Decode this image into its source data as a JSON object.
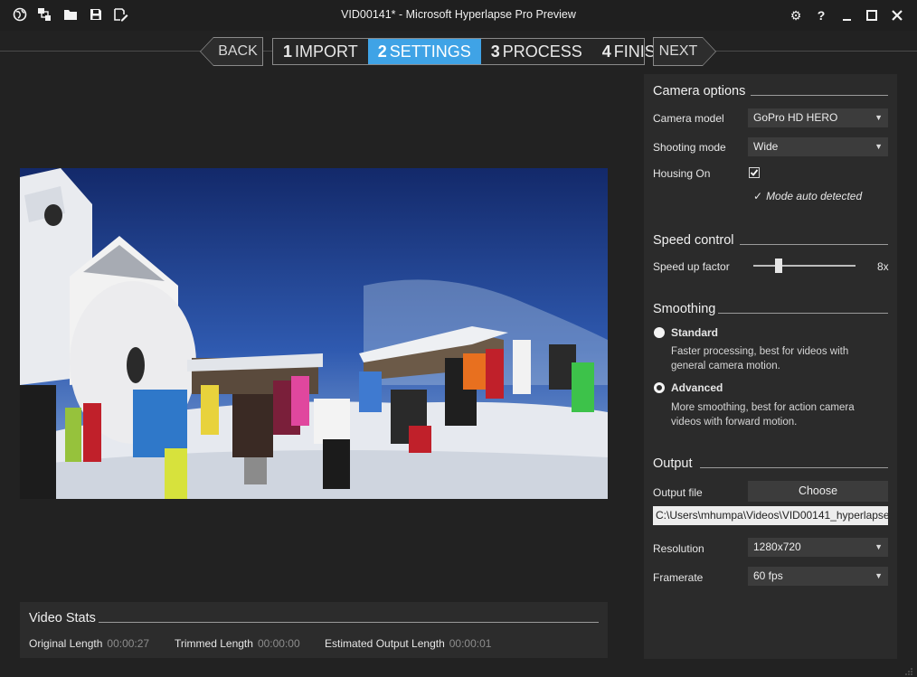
{
  "window": {
    "title": "VID00141* - Microsoft Hyperlapse Pro Preview"
  },
  "toolbar_icons": [
    "globe-icon",
    "import-files-icon",
    "folder-icon",
    "save-icon",
    "save-as-icon"
  ],
  "nav": {
    "back_label": "BACK",
    "next_label": "NEXT",
    "steps": [
      {
        "num": "1",
        "label": "IMPORT"
      },
      {
        "num": "2",
        "label": "SETTINGS"
      },
      {
        "num": "3",
        "label": "PROCESS"
      },
      {
        "num": "4",
        "label": "FINISH"
      }
    ],
    "active_step": 1
  },
  "video_stats": {
    "title": "Video Stats",
    "original_length_label": "Original Length",
    "original_length_value": "00:00:27",
    "trimmed_length_label": "Trimmed Length",
    "trimmed_length_value": "00:00:00",
    "estimated_output_label": "Estimated Output Length",
    "estimated_output_value": "00:00:01"
  },
  "camera_options": {
    "title": "Camera options",
    "camera_model_label": "Camera model",
    "camera_model_value": "GoPro HD HERO",
    "shooting_mode_label": "Shooting mode",
    "shooting_mode_value": "Wide",
    "housing_label": "Housing On",
    "housing_checked": true,
    "auto_detected_text": "Mode auto detected"
  },
  "speed_control": {
    "title": "Speed control",
    "speed_label": "Speed up factor",
    "speed_value": "8x",
    "slider_fraction": 0.25
  },
  "smoothing": {
    "title": "Smoothing",
    "options": [
      {
        "label": "Standard",
        "description": "Faster processing, best for videos with general camera motion.",
        "selected": false
      },
      {
        "label": "Advanced",
        "description": "More smoothing, best for action camera videos with forward motion.",
        "selected": true
      }
    ]
  },
  "output": {
    "title": "Output",
    "output_file_label": "Output file",
    "choose_label": "Choose",
    "file_path": "C:\\Users\\mhumpa\\Videos\\VID00141_hyperlapse",
    "resolution_label": "Resolution",
    "resolution_value": "1280x720",
    "framerate_label": "Framerate",
    "framerate_value": "60 fps"
  },
  "colors": {
    "accent": "#3fa3e6",
    "background": "#222222",
    "panel": "#2b2b2b"
  }
}
